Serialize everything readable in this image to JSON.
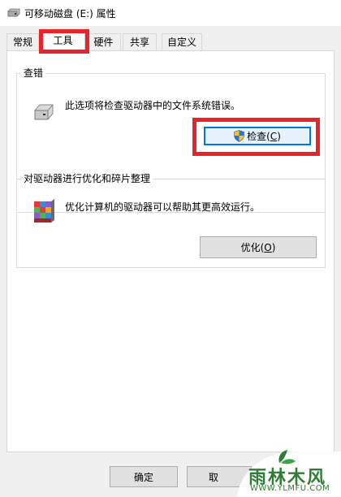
{
  "window": {
    "title": "可移动磁盘 (E:) 属性"
  },
  "tabs": [
    {
      "label": "常规"
    },
    {
      "label": "工具"
    },
    {
      "label": "硬件"
    },
    {
      "label": "共享"
    },
    {
      "label": "自定义"
    }
  ],
  "check_section": {
    "title": "查错",
    "description": "此选项将检查驱动器中的文件系统错误。",
    "button_label": "检查(",
    "button_mnemonic": "C",
    "button_suffix": ")"
  },
  "optimize_section": {
    "title": "对驱动器进行优化和碎片整理",
    "description": "优化计算机的驱动器可以帮助其更高效运行。",
    "button_label": "优化(",
    "button_mnemonic": "O",
    "button_suffix": ")"
  },
  "footer": {
    "ok_label": "确定",
    "cancel_label_partial": "取"
  },
  "watermark": {
    "text": "雨林木风",
    "url": "WWW.YLMFU.COM"
  },
  "colors": {
    "highlight_red": "#e8242a",
    "watermark_green": "#2e7d32"
  }
}
